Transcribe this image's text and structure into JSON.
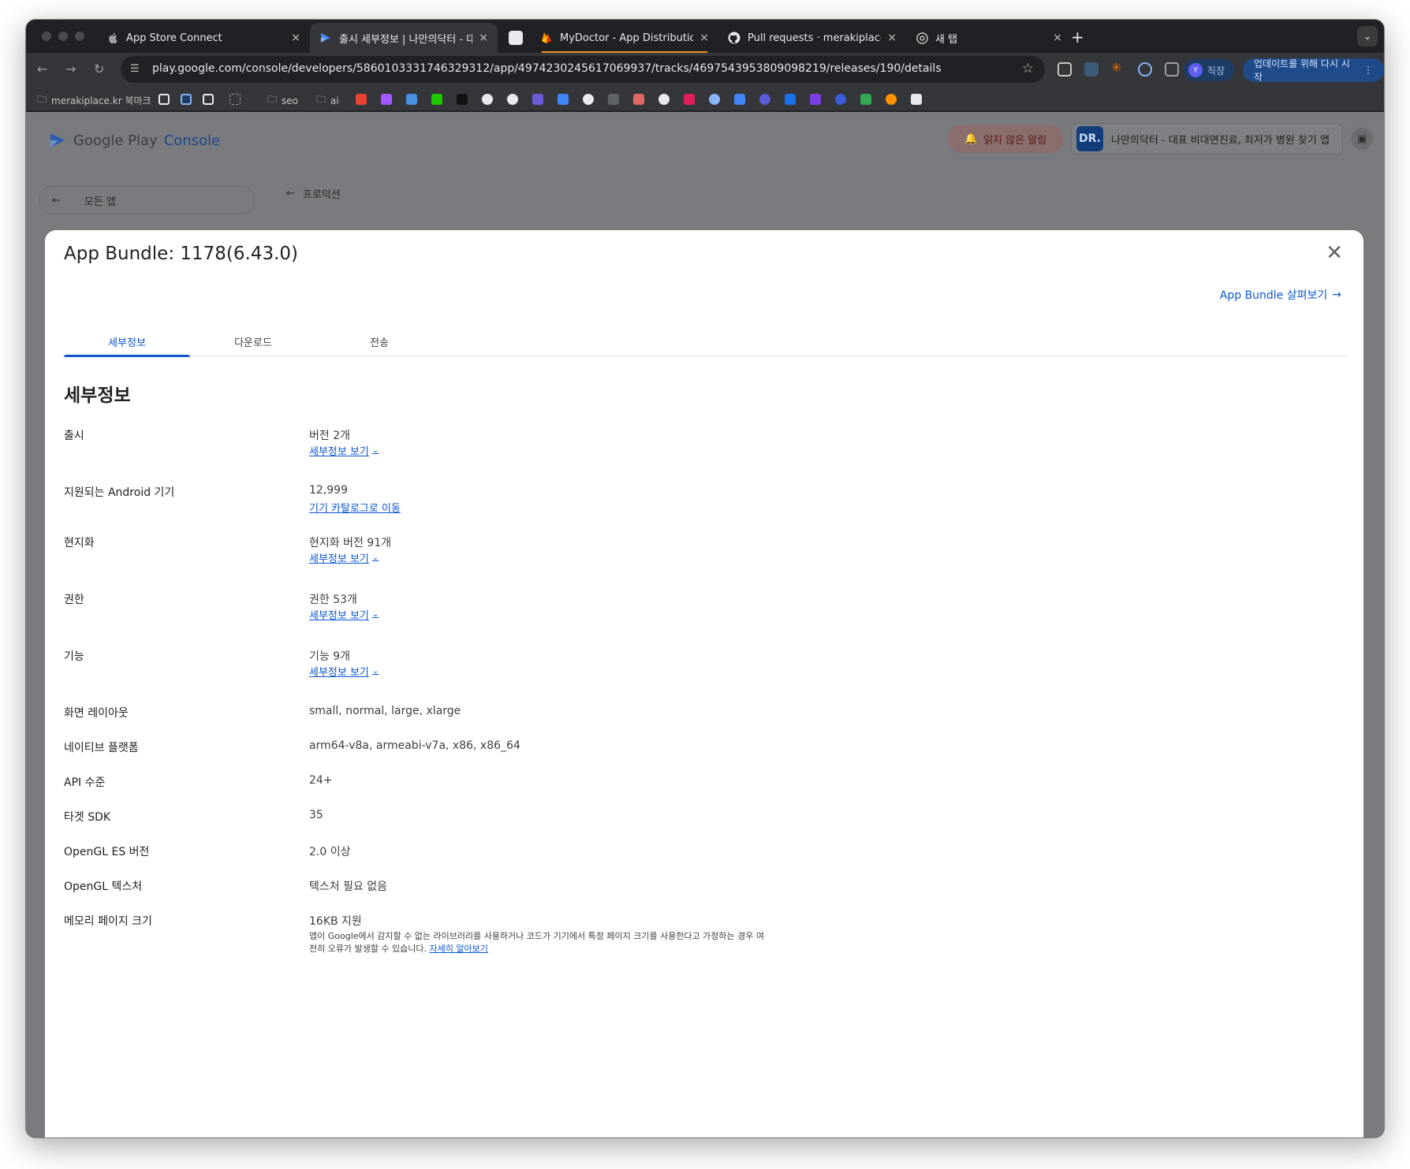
{
  "browser": {
    "tabs": [
      {
        "title": "App Store Connect",
        "icon": "apple-icon",
        "close": "×"
      },
      {
        "title": "출시 세부정보 | 나만의닥터 - 대표",
        "icon": "play-console-icon",
        "close": "×"
      },
      {
        "title": "",
        "icon": "blank-page-icon",
        "close": ""
      },
      {
        "title": "MyDoctor - App Distribution",
        "icon": "firebase-icon",
        "close": "×"
      },
      {
        "title": "Pull requests · merakiplace-d",
        "icon": "github-icon",
        "close": "×"
      },
      {
        "title": "새 탭",
        "icon": "chrome-icon",
        "close": "×"
      }
    ],
    "new_tab": "+",
    "url": "play.google.com/console/developers/5860103331746329312/app/4974230245617069937/tracks/4697543953809098219/releases/190/details",
    "profile_label": "직장",
    "profile_initial": "Y",
    "relaunch_label": "업데이트를 위해 다시 시작",
    "bookmarks": [
      {
        "label": "merakiplace.kr 북마크"
      },
      {
        "label": "seo"
      },
      {
        "label": "ai"
      }
    ]
  },
  "console": {
    "logo_text": "Google Play",
    "logo_console": "Console",
    "notifications_label": "읽지 않은 알림",
    "app_name": "나만의닥터 - 대표 비대면진료, 최저가 병원 찾기 앱",
    "app_icon_text": "DR.",
    "all_apps_label": "모든 앱",
    "back_label": "프로덕션"
  },
  "modal": {
    "title": "App Bundle: 1178(6.43.0)",
    "explore_label": "App Bundle 살펴보기",
    "tabs": [
      {
        "label": "세부정보",
        "active": true
      },
      {
        "label": "다운로드",
        "active": false
      },
      {
        "label": "전송",
        "active": false
      }
    ],
    "section_title": "세부정보",
    "rows": [
      {
        "label": "출시",
        "value": "버전 2개",
        "link": "세부정보 보기"
      },
      {
        "label": "지원되는 Android 기기",
        "value": "12,999",
        "link": "기기 카탈로그로 이동"
      },
      {
        "label": "현지화",
        "value": "현지화 버전 91개",
        "link": "세부정보 보기"
      },
      {
        "label": "권한",
        "value": "권한 53개",
        "link": "세부정보 보기"
      },
      {
        "label": "기능",
        "value": "기능 9개",
        "link": "세부정보 보기"
      },
      {
        "label": "화면 레이아웃",
        "value": "small, normal, large, xlarge"
      },
      {
        "label": "네이티브 플랫폼",
        "value": "arm64-v8a, armeabi-v7a, x86, x86_64"
      },
      {
        "label": "API 수준",
        "value": "24+"
      },
      {
        "label": "타겟 SDK",
        "value": "35"
      },
      {
        "label": "OpenGL ES 버전",
        "value": "2.0 이상"
      },
      {
        "label": "OpenGL 텍스처",
        "value": "텍스처 필요 없음"
      },
      {
        "label": "메모리 페이지 크기",
        "value": "16KB 지원",
        "note": "앱이 Google에서 감지할 수 없는 라이브러리를 사용하거나 코드가 기기에서 특정 페이지 크기를 사용한다고 가정하는 경우 여전히 오류가 발생할 수 있습니다.",
        "note_link": "자세히 알아보기"
      }
    ]
  },
  "colors": {
    "accent": "#0b57d0",
    "browser_bg": "#202124",
    "toolbar": "#35363a"
  }
}
